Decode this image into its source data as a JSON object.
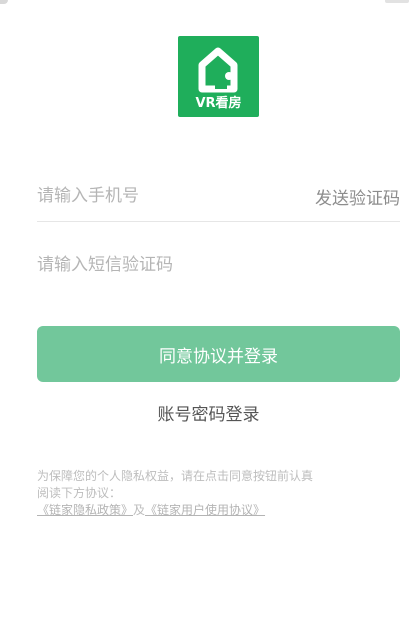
{
  "logo": {
    "icon": "house-icon",
    "label": "VR看房",
    "color": "#1fae5b"
  },
  "phone": {
    "placeholder": "请输入手机号",
    "value": "",
    "send_code_label": "发送验证码"
  },
  "sms_code": {
    "placeholder": "请输入短信验证码",
    "value": ""
  },
  "login_button": {
    "label": "同意协议并登录",
    "color": "#72c79b"
  },
  "password_login": {
    "label": "账号密码登录"
  },
  "agreement": {
    "line1": "为保障您的个人隐私权益，请在点击同意按钮前认真",
    "line2": "阅读下方协议：",
    "privacy_policy": "《链家隐私政策》",
    "joiner": "及",
    "user_agreement": "《链家用户使用协议》"
  }
}
